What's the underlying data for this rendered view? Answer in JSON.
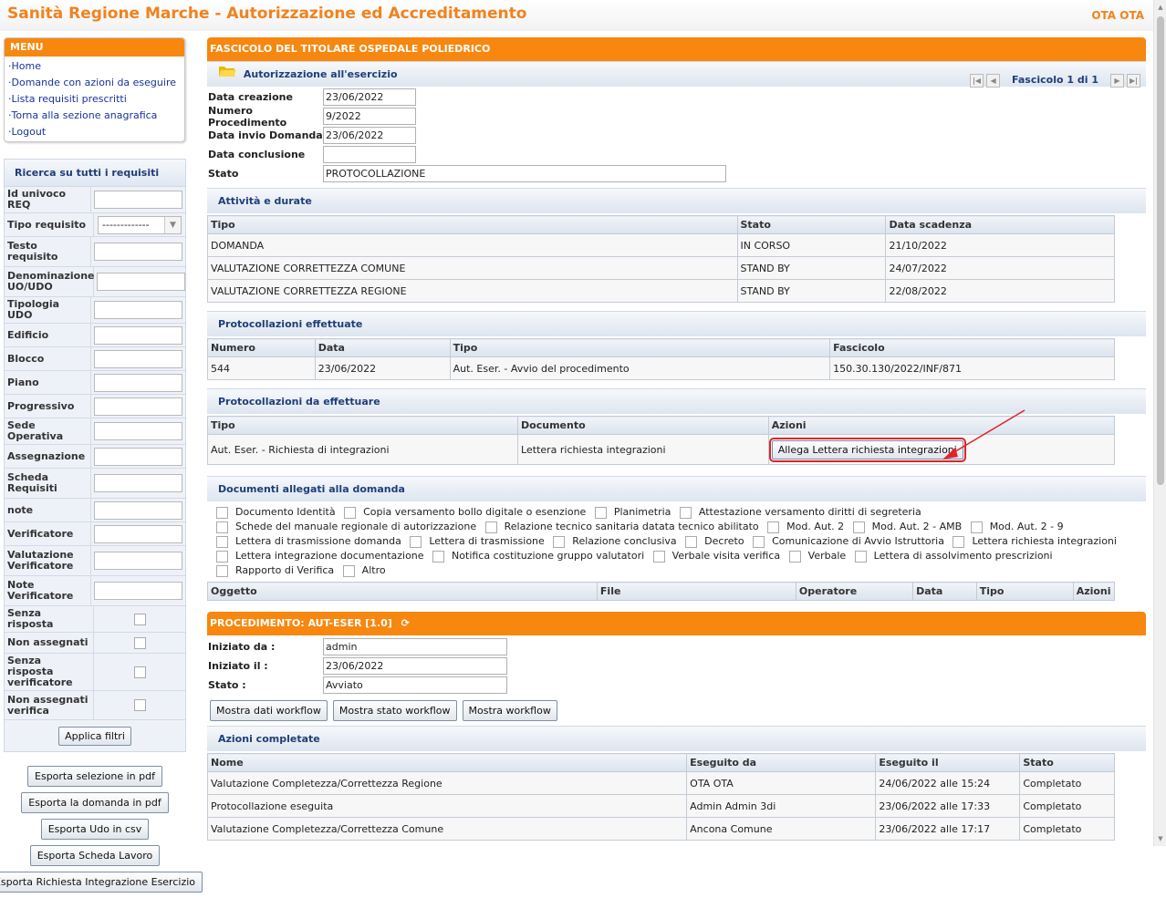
{
  "header": {
    "title": "Sanità Regione Marche - Autorizzazione ed Accreditamento",
    "user": "OTA OTA"
  },
  "menu": {
    "title": "MENU",
    "items": [
      "Home",
      "Domande con azioni da eseguire",
      "Lista requisiti prescritti",
      "Torna alla sezione anagrafica",
      "Logout"
    ]
  },
  "search": {
    "title": "Ricerca su tutti i requisiti",
    "filters": [
      "Id univoco REQ",
      "Tipo requisito",
      "Testo requisito",
      "Denominazione UO/UDO",
      "Tipologia UDO",
      "Edificio",
      "Blocco",
      "Piano",
      "Progressivo",
      "Sede Operativa",
      "Assegnazione",
      "Scheda Requisiti",
      "note",
      "Verificatore",
      "Valutazione Verificatore",
      "Note Verificatore"
    ],
    "tipo_requisito_value": "-------------",
    "checkbox_filters": [
      "Senza risposta",
      "Non assegnati",
      "Senza risposta verificatore",
      "Non assegnati verifica"
    ],
    "apply_label": "Applica filtri"
  },
  "exports": [
    "Esporta selezione in pdf",
    "Esporta la domanda in pdf",
    "Esporta Udo in csv",
    "Esporta Scheda Lavoro",
    "Esporta Richiesta Integrazione Esercizio"
  ],
  "fascicolo": {
    "title": "FASCICOLO DEL TITOLARE OSPEDALE POLIEDRICO",
    "section_title": "Autorizzazione all'esercizio",
    "pager_text": "Fascicolo 1 di 1",
    "fields": [
      {
        "label": "Data creazione",
        "value": "23/06/2022"
      },
      {
        "label": "Numero Procedimento",
        "value": "9/2022"
      },
      {
        "label": "Data invio Domanda",
        "value": "23/06/2022"
      },
      {
        "label": "Data conclusione",
        "value": ""
      },
      {
        "label": "Stato",
        "value": "PROTOCOLLAZIONE"
      }
    ]
  },
  "attivita": {
    "title": "Attività e durate",
    "columns": [
      "Tipo",
      "Stato",
      "Data scadenza"
    ],
    "rows": [
      [
        "DOMANDA",
        "IN CORSO",
        "21/10/2022"
      ],
      [
        "VALUTAZIONE CORRETTEZZA COMUNE",
        "STAND BY",
        "24/07/2022"
      ],
      [
        "VALUTAZIONE CORRETTEZZA REGIONE",
        "STAND BY",
        "22/08/2022"
      ]
    ]
  },
  "protocollazioni_effettuate": {
    "title": "Protocollazioni effettuate",
    "columns": [
      "Numero",
      "Data",
      "Tipo",
      "Fascicolo"
    ],
    "rows": [
      [
        "544",
        "23/06/2022",
        "Aut. Eser. - Avvio del procedimento",
        "150.30.130/2022/INF/871"
      ]
    ]
  },
  "protocollazioni_da_effettuare": {
    "title": "Protocollazioni da effettuare",
    "columns": [
      "Tipo",
      "Documento",
      "Azioni"
    ],
    "rows": [
      [
        "Aut. Eser. - Richiesta di integrazioni",
        "Lettera richiesta integrazioni",
        "Allega Lettera richiesta integrazioni"
      ]
    ]
  },
  "documenti": {
    "title": "Documenti allegati alla domanda",
    "types": [
      "Documento Identità",
      "Copia versamento bollo digitale o esenzione",
      "Planimetria",
      "Attestazione versamento diritti di segreteria",
      "Schede del manuale regionale di autorizzazione",
      "Relazione tecnico sanitaria datata tecnico abilitato",
      "Mod. Aut. 2",
      "Mod. Aut. 2 - AMB",
      "Mod. Aut. 2 - 9",
      "Lettera di trasmissione domanda",
      "Lettera di trasmissione",
      "Relazione conclusiva",
      "Decreto",
      "Comunicazione di Avvio Istruttoria",
      "Lettera richiesta integrazioni",
      "Lettera integrazione documentazione",
      "Notifica costituzione gruppo valutatori",
      "Verbale visita verifica",
      "Verbale",
      "Lettera di assolvimento prescrizioni",
      "Rapporto di Verifica",
      "Altro"
    ],
    "columns": [
      "Oggetto",
      "File",
      "Operatore",
      "Data",
      "Tipo",
      "Azioni"
    ]
  },
  "procedimento": {
    "title": "PROCEDIMENTO: AUT-ESER [1.0]",
    "fields": [
      {
        "label": "Iniziato da :",
        "value": "admin"
      },
      {
        "label": "Iniziato il :",
        "value": "23/06/2022"
      },
      {
        "label": "Stato :",
        "value": "Avviato"
      }
    ],
    "buttons": [
      "Mostra dati workflow",
      "Mostra stato workflow",
      "Mostra workflow"
    ]
  },
  "azioni_completate": {
    "title": "Azioni completate",
    "columns": [
      "Nome",
      "Eseguito da",
      "Eseguito il",
      "Stato"
    ],
    "rows": [
      [
        "Valutazione Completezza/Correttezza Regione",
        "OTA OTA",
        "24/06/2022 alle 15:24",
        "Completato"
      ],
      [
        "Protocollazione eseguita",
        "Admin Admin 3di",
        "23/06/2022 alle 17:33",
        "Completato"
      ],
      [
        "Valutazione Completezza/Correttezza Comune",
        "Ancona Comune",
        "23/06/2022 alle 17:17",
        "Completato"
      ]
    ]
  },
  "colors": {
    "accent": "#f7870f",
    "title": "#f0821e",
    "section_text": "#1f3e78",
    "highlight": "#d9262c"
  }
}
